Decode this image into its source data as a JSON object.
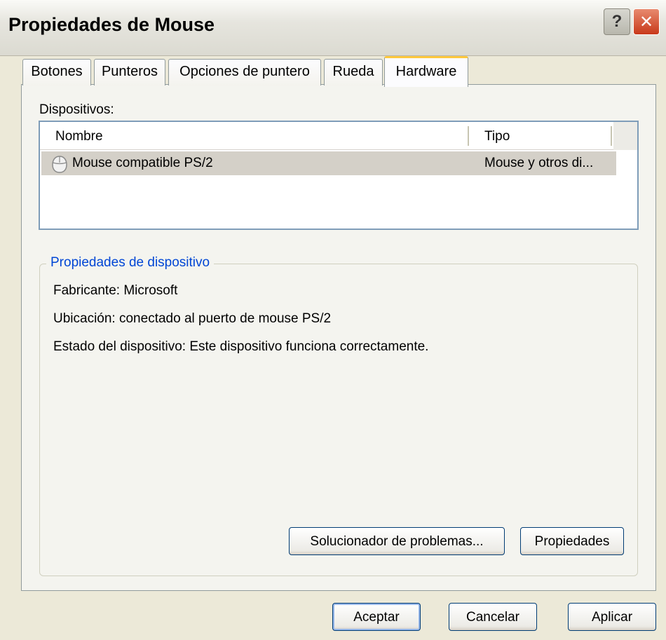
{
  "window": {
    "title": "Propiedades de Mouse"
  },
  "titlebar_buttons": {
    "help": "?",
    "close": "✕"
  },
  "tabs": [
    {
      "label": "Botones",
      "active": false
    },
    {
      "label": "Punteros",
      "active": false
    },
    {
      "label": "Opciones de puntero",
      "active": false
    },
    {
      "label": "Rueda",
      "active": false
    },
    {
      "label": "Hardware",
      "active": true
    }
  ],
  "devices": {
    "label": "Dispositivos:",
    "columns": [
      "Nombre",
      "Tipo"
    ],
    "rows": [
      {
        "icon": "mouse-icon",
        "name": "Mouse compatible PS/2",
        "type": "Mouse y otros di...",
        "selected": true
      }
    ]
  },
  "device_properties": {
    "title": "Propiedades de dispositivo",
    "manufacturer": "Fabricante: Microsoft",
    "location": "Ubicación: conectado al puerto de mouse PS/2",
    "status": "Estado del dispositivo: Este dispositivo funciona correctamente.",
    "troubleshoot_button": "Solucionador de problemas...",
    "properties_button": "Propiedades"
  },
  "footer": {
    "ok": "Aceptar",
    "cancel": "Cancelar",
    "apply": "Aplicar"
  },
  "colors": {
    "accent_tab": "#ffc83c",
    "group_title": "#0046d5",
    "selection": "#d4d0c8"
  }
}
